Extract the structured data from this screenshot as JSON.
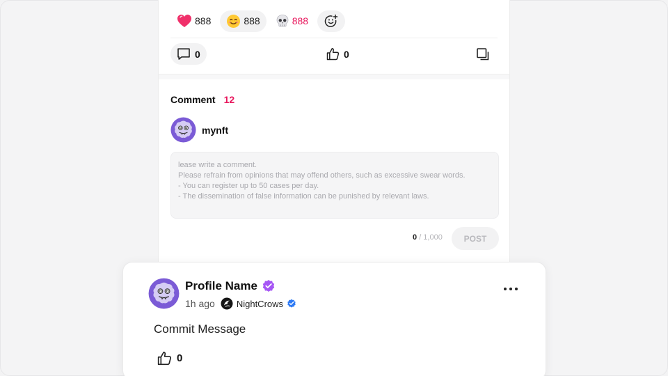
{
  "reactions": [
    {
      "icon": "heart-icon",
      "count": "888",
      "active": false,
      "count_color": "#222222"
    },
    {
      "icon": "smile-icon",
      "count": "888",
      "active": true,
      "count_color": "#222222"
    },
    {
      "icon": "skull-icon",
      "count": "888",
      "active": false,
      "count_color": "#e8175d"
    }
  ],
  "actions": {
    "comment_count": "0",
    "like_count": "0"
  },
  "comments_section": {
    "title": "Comment",
    "count": "12",
    "user_name": "mynft",
    "placeholder_lines": [
      "lease write a comment.",
      "Please refrain from opinions that may offend others, such as excessive swear words.",
      "- You can register up to 50 cases per day.",
      "- The dissemination of false information can be punished by relevant laws."
    ],
    "char_count": "0",
    "char_limit": "/ 1,000",
    "post_label": "POST"
  },
  "comment_card": {
    "profile_name": "Profile Name",
    "time": "1h ago",
    "channel": "NightCrows",
    "message": "Commit Message",
    "like_count": "0"
  },
  "colors": {
    "accent": "#e8175d",
    "verified_purple": "#a656f5",
    "verified_blue": "#2f7bf5",
    "avatar_purple": "#7b5bd6"
  }
}
